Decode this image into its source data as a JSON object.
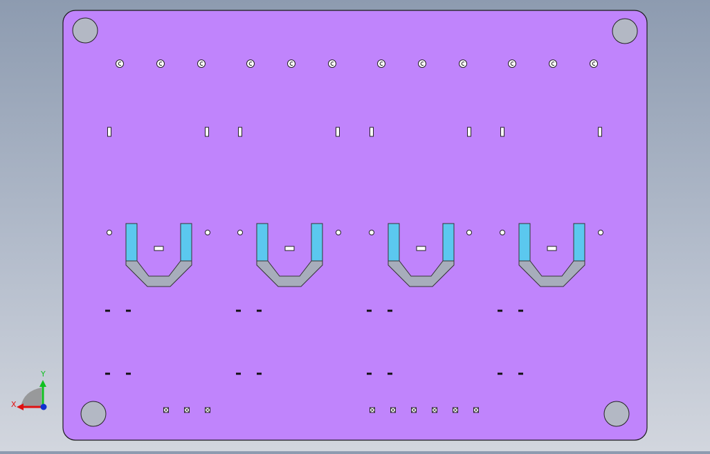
{
  "colors": {
    "background_top": "#8d9bb0",
    "background_bottom": "#d2d6de",
    "plate_fill": "#c084fc",
    "plate_edge": "#1a1a1a",
    "hole_fill": "#b3b8c4",
    "slot_fill": "#ffffff",
    "u_channel_blue": "#5bc8ef",
    "u_channel_gray": "#a7adbb"
  },
  "triad": {
    "x_label": "X",
    "y_label": "Y",
    "x_color": "#e01010",
    "y_color": "#10c020",
    "origin_color": "#1030d0"
  },
  "features": {
    "corner_holes": 4,
    "screw_holes": 12,
    "vertical_slots": 8,
    "u_channels": 4,
    "small_holes": 8,
    "dash_marks": 16,
    "crossed_squares": 9
  }
}
